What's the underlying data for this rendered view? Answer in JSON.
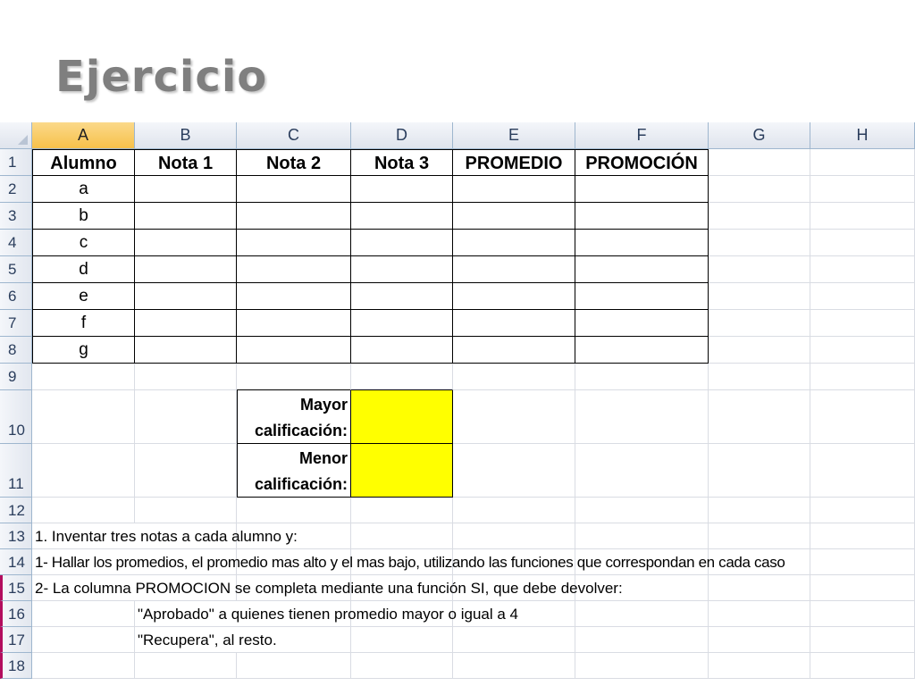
{
  "slide": {
    "title": "Ejercicio"
  },
  "spreadsheet": {
    "columns": [
      "A",
      "B",
      "C",
      "D",
      "E",
      "F",
      "G",
      "H"
    ],
    "selected_column": "A",
    "header": [
      "Alumno",
      "Nota 1",
      "Nota 2",
      "Nota 3",
      "PROMEDIO",
      "PROMOCIÓN"
    ],
    "students": [
      "a",
      "b",
      "c",
      "d",
      "e",
      "f",
      "g"
    ],
    "row_numbers": [
      "1",
      "2",
      "3",
      "4",
      "5",
      "6",
      "7",
      "8",
      "9",
      "10",
      "11",
      "12",
      "13",
      "14",
      "15",
      "16",
      "17",
      "18"
    ],
    "summary": {
      "max_line1": "Mayor",
      "max_line2": "calificación:",
      "min_line1": "Menor",
      "min_line2": "calificación:",
      "highlight_color": "#ffff00"
    },
    "instructions": [
      "1. Inventar tres notas a cada alumno y:",
      "1- Hallar los promedios, el promedio mas alto y el mas bajo, utilizando las funciones que correspondan en cada caso",
      "2- La columna PROMOCION se completa mediante una función SI, que debe devolver:",
      "\"Aprobado\" a quienes tienen promedio mayor o igual a 4",
      "\"Recupera\", al resto."
    ]
  }
}
